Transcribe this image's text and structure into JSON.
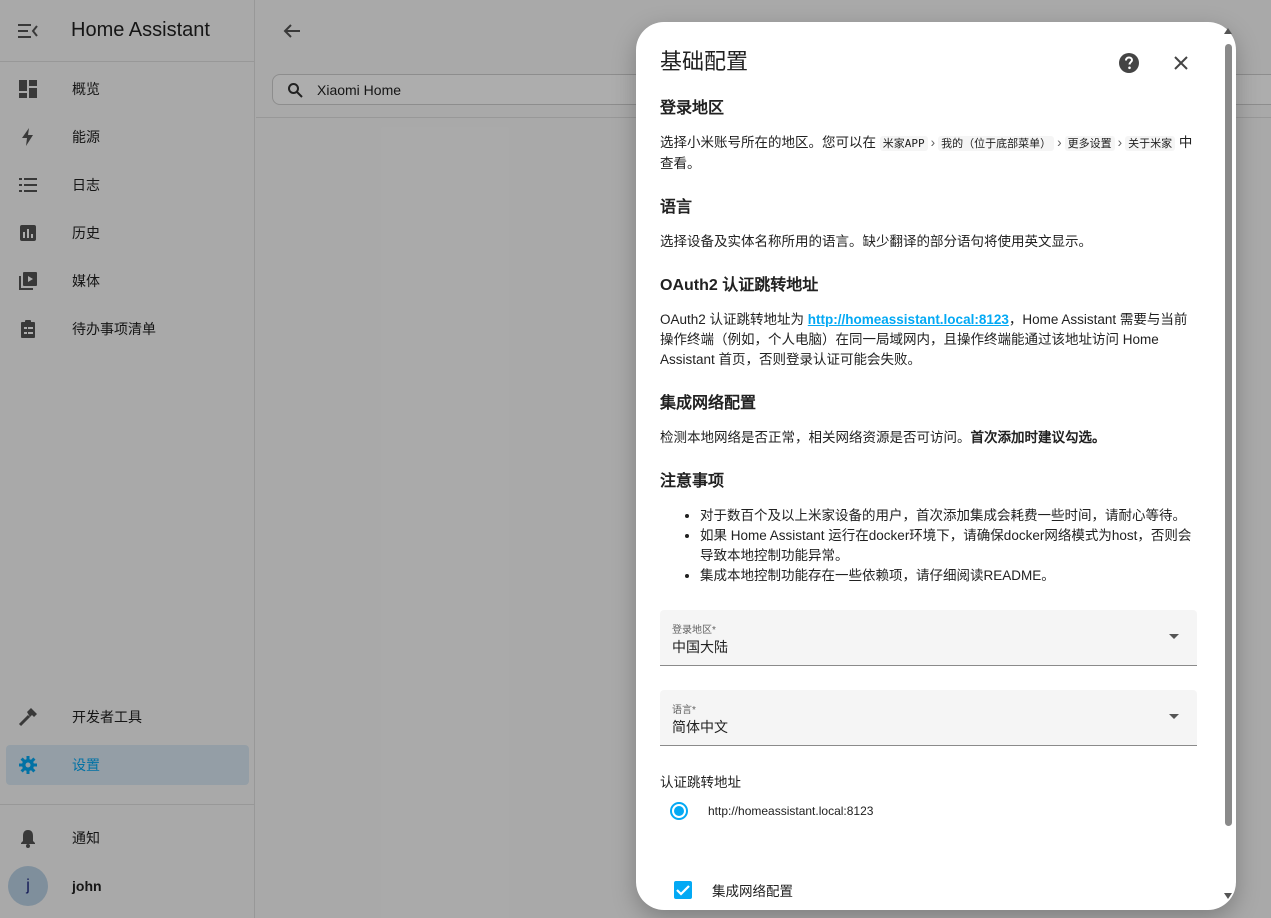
{
  "app": {
    "title": "Home Assistant"
  },
  "sidebar": {
    "items": [
      {
        "label": "概览",
        "icon": "dashboard-icon"
      },
      {
        "label": "能源",
        "icon": "lightning-icon"
      },
      {
        "label": "日志",
        "icon": "logbook-list-icon"
      },
      {
        "label": "历史",
        "icon": "history-chart-icon"
      },
      {
        "label": "媒体",
        "icon": "media-play-icon"
      },
      {
        "label": "待办事项清单",
        "icon": "todo-clipboard-icon"
      }
    ],
    "bottom_items": [
      {
        "label": "开发者工具",
        "icon": "hammer-icon"
      },
      {
        "label": "设置",
        "icon": "gear-icon",
        "selected": true
      }
    ],
    "notifications": {
      "label": "通知",
      "icon": "bell-icon"
    },
    "user": {
      "initial": "j",
      "name": "john"
    }
  },
  "main": {
    "search_value": "Xiaomi Home"
  },
  "dialog": {
    "title": "基础配置",
    "sections": {
      "region": {
        "heading": "登录地区",
        "text_pre": "选择小米账号所在的地区。您可以在",
        "crumb1": "米家APP",
        "crumb2": "我的（位于底部菜单）",
        "crumb3": "更多设置",
        "crumb4": "关于米家",
        "text_post": "中查看。"
      },
      "language": {
        "heading": "语言",
        "text": "选择设备及实体名称所用的语言。缺少翻译的部分语句将使用英文显示。"
      },
      "oauth": {
        "heading": "OAuth2 认证跳转地址",
        "text_pre": "OAuth2 认证跳转地址为 ",
        "link": "http://homeassistant.local:8123",
        "text_post": "，Home Assistant 需要与当前操作终端（例如，个人电脑）在同一局域网内，且操作终端能通过该地址访问 Home Assistant 首页，否则登录认证可能会失败。"
      },
      "network": {
        "heading": "集成网络配置",
        "text": "检测本地网络是否正常，相关网络资源是否可访问。",
        "bold": "首次添加时建议勾选。"
      },
      "notes": {
        "heading": "注意事项",
        "items": [
          "对于数百个及以上米家设备的用户，首次添加集成会耗费一些时间，请耐心等待。",
          "如果 Home Assistant 运行在docker环境下，请确保docker网络模式为host，否则会导致本地控制功能异常。",
          "集成本地控制功能存在一些依赖项，请仔细阅读README。"
        ]
      }
    },
    "form": {
      "region_label": "登录地区*",
      "region_value": "中国大陆",
      "language_label": "语言*",
      "language_value": "简体中文",
      "redirect_label": "认证跳转地址",
      "redirect_option": "http://homeassistant.local:8123",
      "network_checkbox_label": "集成网络配置",
      "network_checkbox_checked": true
    }
  },
  "colors": {
    "accent": "#03a9f4",
    "selected_bg": "#dbe9f5"
  }
}
